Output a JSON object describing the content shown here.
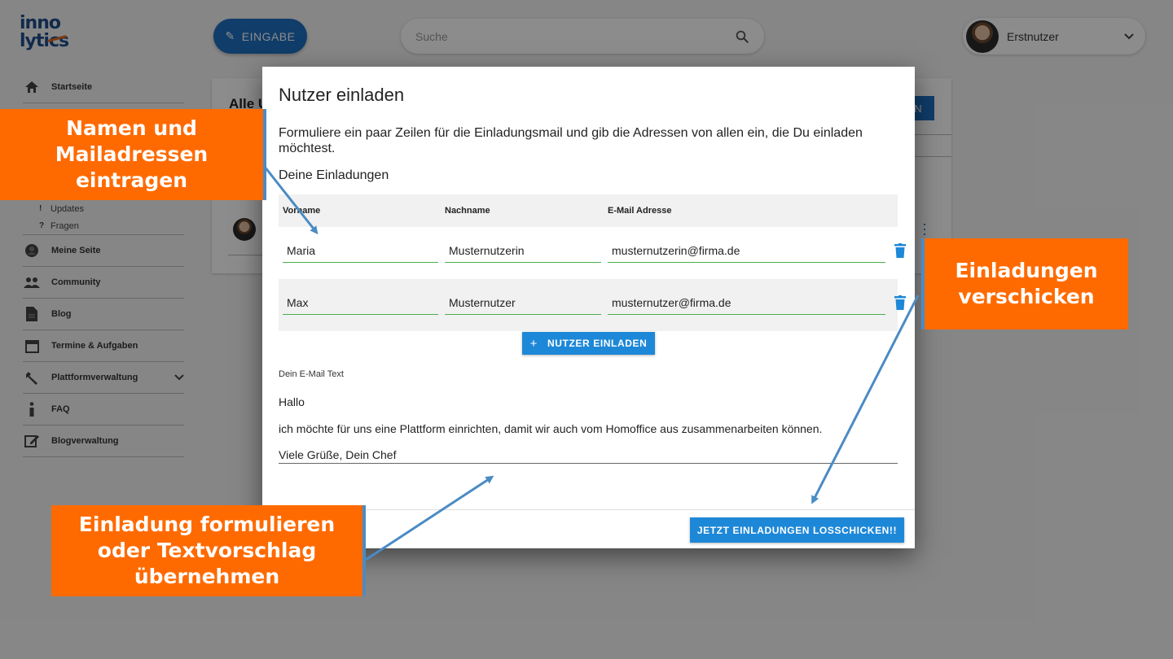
{
  "logo": {
    "line1": "inno",
    "line2": "lytics"
  },
  "header": {
    "eingabe_label": "EINGABE",
    "search_placeholder": "Suche",
    "user_name": "Erstnutzer"
  },
  "sidebar": {
    "items_top": [
      {
        "label": "Startseite",
        "icon": "home-icon"
      }
    ],
    "sub_items": [
      {
        "marker": "!",
        "label": "Updates"
      },
      {
        "marker": "?",
        "label": "Fragen"
      }
    ],
    "items": [
      {
        "label": "Meine Seite",
        "icon": "account-icon"
      },
      {
        "label": "Community",
        "icon": "people-icon"
      },
      {
        "label": "Blog",
        "icon": "document-icon"
      },
      {
        "label": "Termine & Aufgaben",
        "icon": "calendar-icon"
      },
      {
        "label": "Plattformverwaltung",
        "icon": "wrench-icon"
      },
      {
        "label": "FAQ",
        "icon": "info-icon"
      },
      {
        "label": "Blogverwaltung",
        "icon": "edit-icon"
      }
    ]
  },
  "card": {
    "title": "Alle U",
    "button_label": "N"
  },
  "modal": {
    "title": "Nutzer einladen",
    "description": "Formuliere ein paar Zeilen für die Einladungsmail und gib die Adressen von allen ein, die Du einladen möchtest.",
    "section_title": "Deine Einladungen",
    "columns": {
      "first": "Vorname",
      "last": "Nachname",
      "email": "E-Mail Adresse"
    },
    "rows": [
      {
        "first": "Maria",
        "last": "Musternutzerin",
        "email": "musternutzerin@firma.de"
      },
      {
        "first": "Max",
        "last": "Musternutzer",
        "email": "musternutzer@firma.de"
      }
    ],
    "add_button": "NUTZER EINLADEN",
    "mail_label": "Dein E-Mail Text",
    "mail_lines": [
      "Hallo",
      "ich möchte für uns eine Plattform einrichten, damit wir auch vom Homoffice aus zusammenarbeiten können.",
      "Viele Grüße, Dein Chef"
    ],
    "send_button": "JETZT EINLADUNGEN LOSSCHICKEN!!"
  },
  "annotations": {
    "names": [
      "Namen und",
      "Mailadressen",
      "eintragen"
    ],
    "send": [
      "Einladungen",
      "verschicken"
    ],
    "compose": [
      "Einladung formulieren",
      "oder Textvorschlag",
      "übernehmen"
    ]
  },
  "colors": {
    "accent_blue": "#1e88d8",
    "annotation_orange": "#ff6a00",
    "field_underline": "#4caf50"
  }
}
